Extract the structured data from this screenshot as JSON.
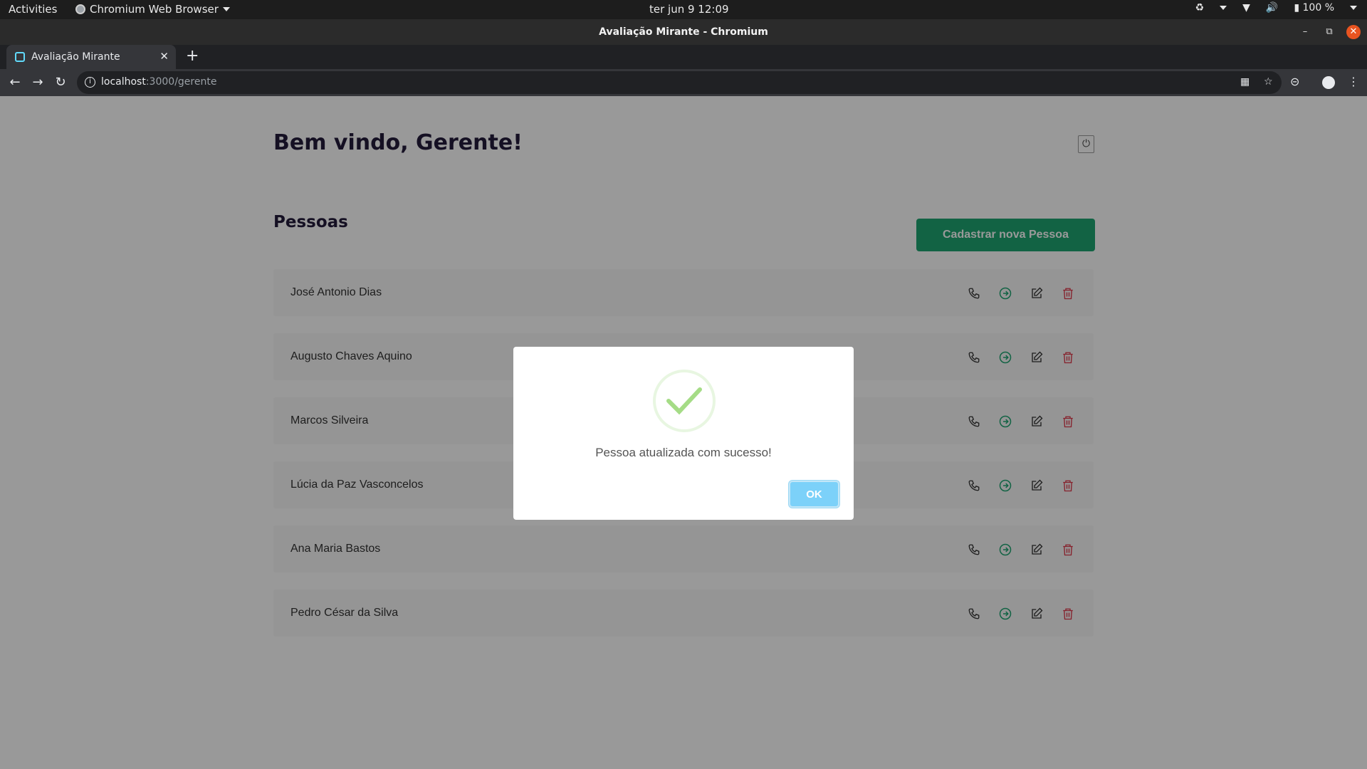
{
  "system_bar": {
    "activities": "Activities",
    "app_name": "Chromium Web Browser",
    "clock": "ter jun 9  12:09",
    "battery": "100 %"
  },
  "window": {
    "title": "Avaliação Mirante - Chromium"
  },
  "tabs": [
    {
      "label": "Avaliação Mirante"
    }
  ],
  "address_bar": {
    "host": "localhost",
    "path": ":3000/gerente"
  },
  "page": {
    "welcome": "Bem vindo, Gerente!",
    "section_title": "Pessoas",
    "add_button": "Cadastrar nova Pessoa",
    "people": [
      {
        "name": "José Antonio Dias"
      },
      {
        "name": "Augusto Chaves Aquino"
      },
      {
        "name": "Marcos Silveira"
      },
      {
        "name": "Lúcia da Paz Vasconcelos"
      },
      {
        "name": "Ana Maria Bastos"
      },
      {
        "name": "Pedro César da Silva"
      }
    ]
  },
  "modal": {
    "message": "Pessoa atualizada com sucesso!",
    "ok_label": "OK"
  },
  "colors": {
    "accent_green": "#1ea672",
    "delete_red": "#e0384a",
    "ok_blue": "#7cd1f9",
    "success_check": "#a5dc86"
  }
}
